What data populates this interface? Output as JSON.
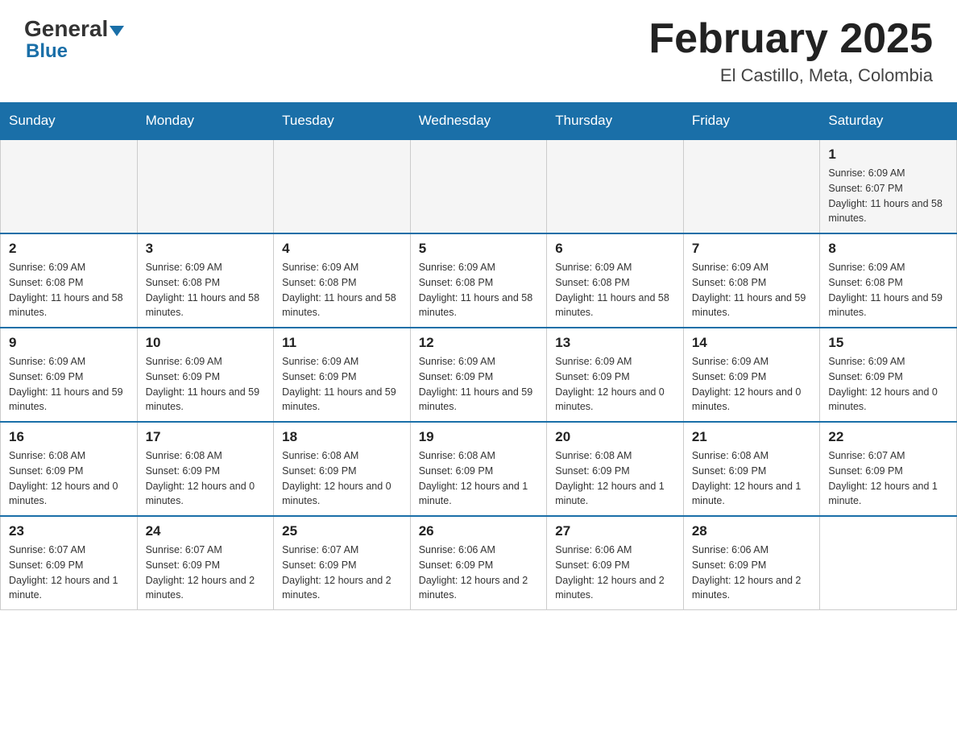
{
  "header": {
    "logo_general": "General",
    "logo_blue": "Blue",
    "month_title": "February 2025",
    "location": "El Castillo, Meta, Colombia"
  },
  "weekdays": [
    "Sunday",
    "Monday",
    "Tuesday",
    "Wednesday",
    "Thursday",
    "Friday",
    "Saturday"
  ],
  "weeks": [
    [
      {
        "day": "",
        "sunrise": "",
        "sunset": "",
        "daylight": ""
      },
      {
        "day": "",
        "sunrise": "",
        "sunset": "",
        "daylight": ""
      },
      {
        "day": "",
        "sunrise": "",
        "sunset": "",
        "daylight": ""
      },
      {
        "day": "",
        "sunrise": "",
        "sunset": "",
        "daylight": ""
      },
      {
        "day": "",
        "sunrise": "",
        "sunset": "",
        "daylight": ""
      },
      {
        "day": "",
        "sunrise": "",
        "sunset": "",
        "daylight": ""
      },
      {
        "day": "1",
        "sunrise": "Sunrise: 6:09 AM",
        "sunset": "Sunset: 6:07 PM",
        "daylight": "Daylight: 11 hours and 58 minutes."
      }
    ],
    [
      {
        "day": "2",
        "sunrise": "Sunrise: 6:09 AM",
        "sunset": "Sunset: 6:08 PM",
        "daylight": "Daylight: 11 hours and 58 minutes."
      },
      {
        "day": "3",
        "sunrise": "Sunrise: 6:09 AM",
        "sunset": "Sunset: 6:08 PM",
        "daylight": "Daylight: 11 hours and 58 minutes."
      },
      {
        "day": "4",
        "sunrise": "Sunrise: 6:09 AM",
        "sunset": "Sunset: 6:08 PM",
        "daylight": "Daylight: 11 hours and 58 minutes."
      },
      {
        "day": "5",
        "sunrise": "Sunrise: 6:09 AM",
        "sunset": "Sunset: 6:08 PM",
        "daylight": "Daylight: 11 hours and 58 minutes."
      },
      {
        "day": "6",
        "sunrise": "Sunrise: 6:09 AM",
        "sunset": "Sunset: 6:08 PM",
        "daylight": "Daylight: 11 hours and 58 minutes."
      },
      {
        "day": "7",
        "sunrise": "Sunrise: 6:09 AM",
        "sunset": "Sunset: 6:08 PM",
        "daylight": "Daylight: 11 hours and 59 minutes."
      },
      {
        "day": "8",
        "sunrise": "Sunrise: 6:09 AM",
        "sunset": "Sunset: 6:08 PM",
        "daylight": "Daylight: 11 hours and 59 minutes."
      }
    ],
    [
      {
        "day": "9",
        "sunrise": "Sunrise: 6:09 AM",
        "sunset": "Sunset: 6:09 PM",
        "daylight": "Daylight: 11 hours and 59 minutes."
      },
      {
        "day": "10",
        "sunrise": "Sunrise: 6:09 AM",
        "sunset": "Sunset: 6:09 PM",
        "daylight": "Daylight: 11 hours and 59 minutes."
      },
      {
        "day": "11",
        "sunrise": "Sunrise: 6:09 AM",
        "sunset": "Sunset: 6:09 PM",
        "daylight": "Daylight: 11 hours and 59 minutes."
      },
      {
        "day": "12",
        "sunrise": "Sunrise: 6:09 AM",
        "sunset": "Sunset: 6:09 PM",
        "daylight": "Daylight: 11 hours and 59 minutes."
      },
      {
        "day": "13",
        "sunrise": "Sunrise: 6:09 AM",
        "sunset": "Sunset: 6:09 PM",
        "daylight": "Daylight: 12 hours and 0 minutes."
      },
      {
        "day": "14",
        "sunrise": "Sunrise: 6:09 AM",
        "sunset": "Sunset: 6:09 PM",
        "daylight": "Daylight: 12 hours and 0 minutes."
      },
      {
        "day": "15",
        "sunrise": "Sunrise: 6:09 AM",
        "sunset": "Sunset: 6:09 PM",
        "daylight": "Daylight: 12 hours and 0 minutes."
      }
    ],
    [
      {
        "day": "16",
        "sunrise": "Sunrise: 6:08 AM",
        "sunset": "Sunset: 6:09 PM",
        "daylight": "Daylight: 12 hours and 0 minutes."
      },
      {
        "day": "17",
        "sunrise": "Sunrise: 6:08 AM",
        "sunset": "Sunset: 6:09 PM",
        "daylight": "Daylight: 12 hours and 0 minutes."
      },
      {
        "day": "18",
        "sunrise": "Sunrise: 6:08 AM",
        "sunset": "Sunset: 6:09 PM",
        "daylight": "Daylight: 12 hours and 0 minutes."
      },
      {
        "day": "19",
        "sunrise": "Sunrise: 6:08 AM",
        "sunset": "Sunset: 6:09 PM",
        "daylight": "Daylight: 12 hours and 1 minute."
      },
      {
        "day": "20",
        "sunrise": "Sunrise: 6:08 AM",
        "sunset": "Sunset: 6:09 PM",
        "daylight": "Daylight: 12 hours and 1 minute."
      },
      {
        "day": "21",
        "sunrise": "Sunrise: 6:08 AM",
        "sunset": "Sunset: 6:09 PM",
        "daylight": "Daylight: 12 hours and 1 minute."
      },
      {
        "day": "22",
        "sunrise": "Sunrise: 6:07 AM",
        "sunset": "Sunset: 6:09 PM",
        "daylight": "Daylight: 12 hours and 1 minute."
      }
    ],
    [
      {
        "day": "23",
        "sunrise": "Sunrise: 6:07 AM",
        "sunset": "Sunset: 6:09 PM",
        "daylight": "Daylight: 12 hours and 1 minute."
      },
      {
        "day": "24",
        "sunrise": "Sunrise: 6:07 AM",
        "sunset": "Sunset: 6:09 PM",
        "daylight": "Daylight: 12 hours and 2 minutes."
      },
      {
        "day": "25",
        "sunrise": "Sunrise: 6:07 AM",
        "sunset": "Sunset: 6:09 PM",
        "daylight": "Daylight: 12 hours and 2 minutes."
      },
      {
        "day": "26",
        "sunrise": "Sunrise: 6:06 AM",
        "sunset": "Sunset: 6:09 PM",
        "daylight": "Daylight: 12 hours and 2 minutes."
      },
      {
        "day": "27",
        "sunrise": "Sunrise: 6:06 AM",
        "sunset": "Sunset: 6:09 PM",
        "daylight": "Daylight: 12 hours and 2 minutes."
      },
      {
        "day": "28",
        "sunrise": "Sunrise: 6:06 AM",
        "sunset": "Sunset: 6:09 PM",
        "daylight": "Daylight: 12 hours and 2 minutes."
      },
      {
        "day": "",
        "sunrise": "",
        "sunset": "",
        "daylight": ""
      }
    ]
  ]
}
